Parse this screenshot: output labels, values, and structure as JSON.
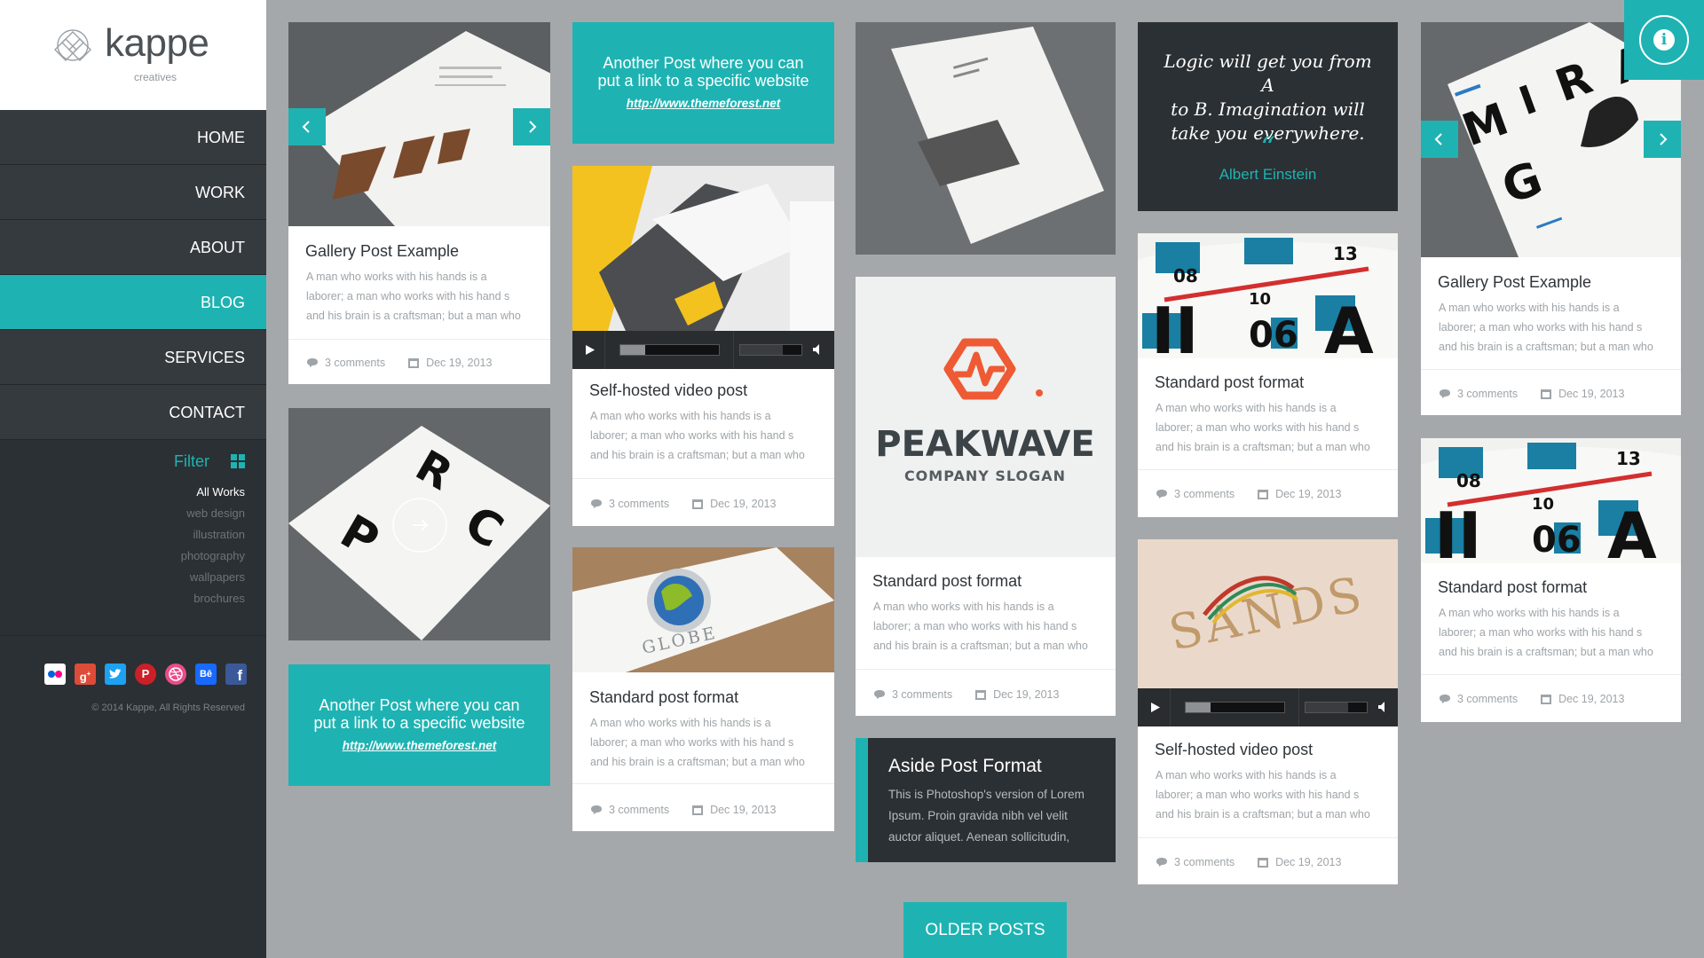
{
  "logo": {
    "brand": "kappe",
    "sub": "creatives"
  },
  "nav": {
    "items": [
      {
        "label": "HOME"
      },
      {
        "label": "WORK"
      },
      {
        "label": "ABOUT"
      },
      {
        "label": "BLOG",
        "active": true
      },
      {
        "label": "SERVICES"
      },
      {
        "label": "CONTACT"
      }
    ]
  },
  "filter": {
    "title": "Filter",
    "items": [
      "All Works",
      "web design",
      "illustration",
      "photography",
      "wallpapers",
      "brochures"
    ],
    "active": "All Works"
  },
  "social": {
    "icons": [
      "flickr-icon",
      "google-plus-icon",
      "twitter-icon",
      "pinterest-icon",
      "dribbble-icon",
      "behance-icon",
      "facebook-icon"
    ]
  },
  "copyright": "© 2014 Kappe, All Rights Reserved",
  "accent_color": "#1eb3b2",
  "excerpt": {
    "line1": "A man who works with his hands is a",
    "line2": "laborer; a man who works with his hand s",
    "line3": "and his brain is a craftsman; but a man who"
  },
  "posts": {
    "gallery1": {
      "title": "Gallery Post Example",
      "comments": "3 comments",
      "date": "Dec 19, 2013"
    },
    "link1": {
      "text_line1": "Another Post where you can",
      "text_line2": "put a link to a specific website",
      "url": "http://www.themeforest.net"
    },
    "link2": {
      "text_line1": "Another Post where you can",
      "text_line2": "put a link to a specific website",
      "url": "http://www.themeforest.net"
    },
    "video1": {
      "title": "Self-hosted video post",
      "comments": "3 comments",
      "date": "Dec 19, 2013"
    },
    "standard_globe": {
      "title": "Standard post format",
      "comments": "3 comments",
      "date": "Dec 19, 2013"
    },
    "standard_peak": {
      "title": "Standard post format",
      "comments": "3 comments",
      "date": "Dec 19, 2013",
      "logo_text": "PEAKWAVE",
      "logo_slogan": "COMPANY SLOGAN"
    },
    "aside": {
      "title": "Aside Post Format",
      "line1": "This is Photoshop's version  of Lorem",
      "line2": "Ipsum. Proin gravida nibh vel velit",
      "line3": "auctor aliquet. Aenean sollicitudin,"
    },
    "quote": {
      "line1": "Logic will get you from A",
      "line2": "to B. Imagination will",
      "line3": "take you everywhere.",
      "mark": "“",
      "author": "Albert Einstein"
    },
    "standard_mag1": {
      "title": "Standard post format",
      "comments": "3 comments",
      "date": "Dec 19, 2013"
    },
    "video2": {
      "title": "Self-hosted video post",
      "comments": "3 comments",
      "date": "Dec 19, 2013",
      "image_text": "SANDS"
    },
    "gallery2": {
      "title": "Gallery Post Example",
      "comments": "3 comments",
      "date": "Dec 19, 2013"
    },
    "standard_mag2": {
      "title": "Standard post format",
      "comments": "3 comments",
      "date": "Dec 19, 2013"
    },
    "globe_text": "GLOBE"
  },
  "older_posts": "OLDER POSTS",
  "info_button": {
    "icon": "info-icon",
    "glyph": "i"
  }
}
